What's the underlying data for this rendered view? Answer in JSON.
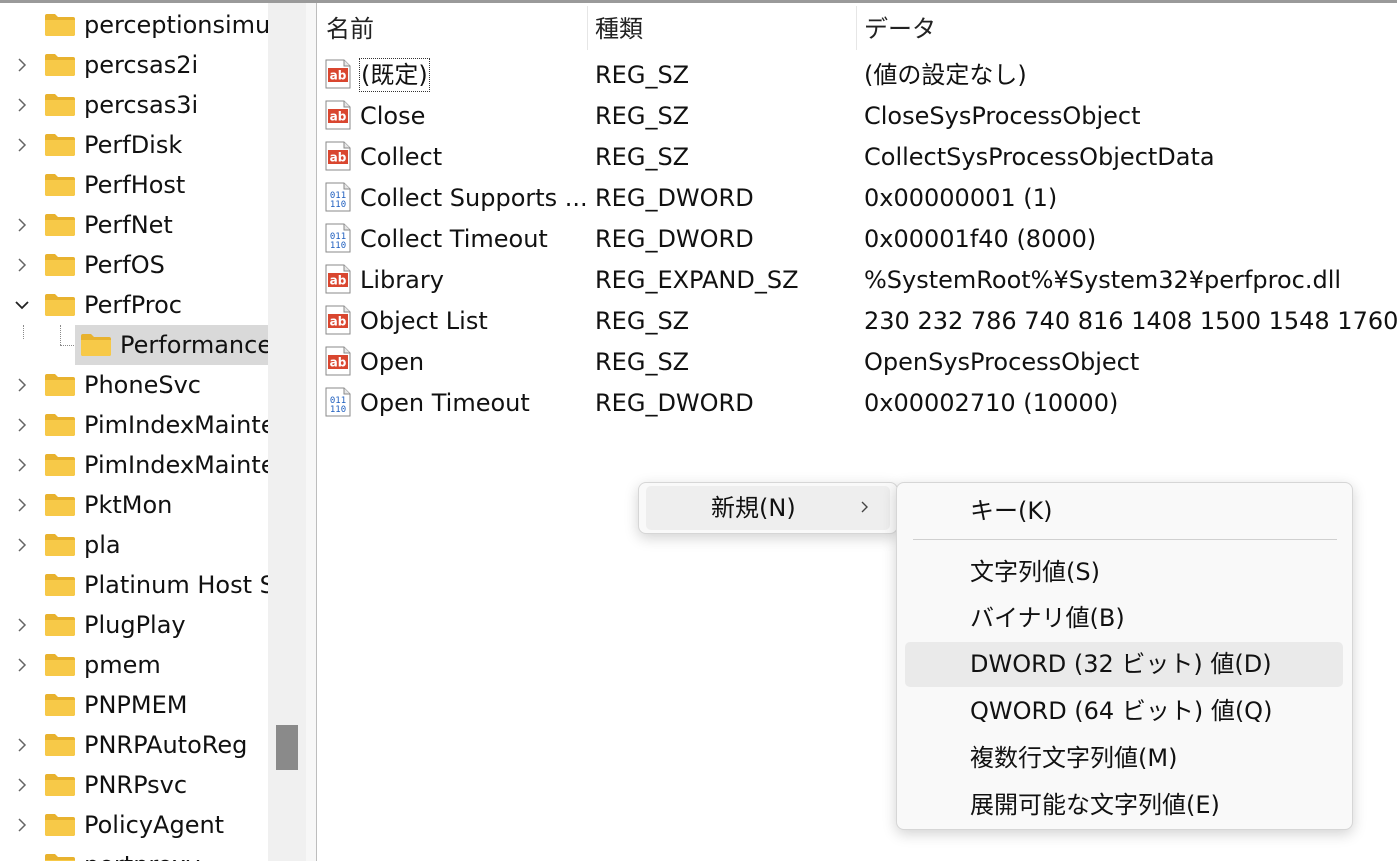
{
  "tree": {
    "items": [
      {
        "label": "perceptionsimu",
        "expandable": false
      },
      {
        "label": "percsas2i",
        "expandable": true
      },
      {
        "label": "percsas3i",
        "expandable": true
      },
      {
        "label": "PerfDisk",
        "expandable": true
      },
      {
        "label": "PerfHost",
        "expandable": false
      },
      {
        "label": "PerfNet",
        "expandable": true
      },
      {
        "label": "PerfOS",
        "expandable": true
      },
      {
        "label": "PerfProc",
        "expandable": "open"
      },
      {
        "label": "Performance",
        "expandable": false,
        "child": true,
        "selected": true
      },
      {
        "label": "PhoneSvc",
        "expandable": true
      },
      {
        "label": "PimIndexMainte",
        "expandable": true
      },
      {
        "label": "PimIndexMainte",
        "expandable": true
      },
      {
        "label": "PktMon",
        "expandable": true
      },
      {
        "label": "pla",
        "expandable": true
      },
      {
        "label": "Platinum Host S",
        "expandable": false
      },
      {
        "label": "PlugPlay",
        "expandable": true
      },
      {
        "label": "pmem",
        "expandable": true
      },
      {
        "label": "PNPMEM",
        "expandable": false
      },
      {
        "label": "PNRPAutoReg",
        "expandable": true
      },
      {
        "label": "PNRPsvc",
        "expandable": true
      },
      {
        "label": "PolicyAgent",
        "expandable": true
      },
      {
        "label": "portproxy",
        "expandable": false
      }
    ]
  },
  "list": {
    "headers": {
      "name": "名前",
      "type": "種類",
      "data": "データ"
    },
    "rows": [
      {
        "icon": "string-value-icon",
        "name": "(既定)",
        "type": "REG_SZ",
        "data": "(値の設定なし)",
        "focused": true
      },
      {
        "icon": "string-value-icon",
        "name": "Close",
        "type": "REG_SZ",
        "data": "CloseSysProcessObject"
      },
      {
        "icon": "string-value-icon",
        "name": "Collect",
        "type": "REG_SZ",
        "data": "CollectSysProcessObjectData"
      },
      {
        "icon": "binary-value-icon",
        "name": "Collect Supports ...",
        "type": "REG_DWORD",
        "data": "0x00000001 (1)"
      },
      {
        "icon": "binary-value-icon",
        "name": "Collect Timeout",
        "type": "REG_DWORD",
        "data": "0x00001f40 (8000)"
      },
      {
        "icon": "string-value-icon",
        "name": "Library",
        "type": "REG_EXPAND_SZ",
        "data": "%SystemRoot%¥System32¥perfproc.dll"
      },
      {
        "icon": "string-value-icon",
        "name": "Object List",
        "type": "REG_SZ",
        "data": "230 232 786 740 816 1408 1500 1548 1760"
      },
      {
        "icon": "string-value-icon",
        "name": "Open",
        "type": "REG_SZ",
        "data": "OpenSysProcessObject"
      },
      {
        "icon": "binary-value-icon",
        "name": "Open Timeout",
        "type": "REG_DWORD",
        "data": "0x00002710 (10000)"
      }
    ]
  },
  "context_menu": {
    "new_label": "新規(N)"
  },
  "submenu": {
    "items": [
      {
        "label": "キー(K)"
      },
      {
        "label": "文字列値(S)"
      },
      {
        "label": "バイナリ値(B)"
      },
      {
        "label": "DWORD (32 ビット) 値(D)",
        "highlighted": true
      },
      {
        "label": "QWORD (64 ビット) 値(Q)"
      },
      {
        "label": "複数行文字列値(M)"
      },
      {
        "label": "展開可能な文字列値(E)"
      }
    ]
  },
  "colors": {
    "folder": "#f7c948",
    "string_icon_red": "#d9462f",
    "binary_icon_blue": "#1f5fbf",
    "selection": "#d9d9d9",
    "menu_highlight": "#eaeaea"
  }
}
